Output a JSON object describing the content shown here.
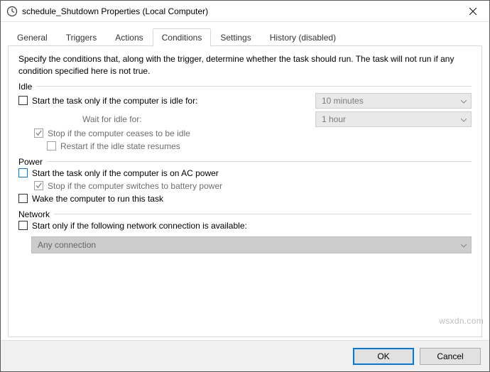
{
  "window": {
    "title": "schedule_Shutdown Properties (Local Computer)"
  },
  "tabs": {
    "general": "General",
    "triggers": "Triggers",
    "actions": "Actions",
    "conditions": "Conditions",
    "settings": "Settings",
    "history": "History (disabled)",
    "active": "conditions"
  },
  "conditions": {
    "description": "Specify the conditions that, along with the trigger, determine whether the task should run.  The task will not run  if any condition specified here is not true.",
    "idle": {
      "label": "Idle",
      "start_only_if_idle": {
        "checked": false,
        "label": "Start the task only if the computer is idle for:",
        "value": "10 minutes"
      },
      "wait_label": "Wait for idle for:",
      "wait_value": "1 hour",
      "stop_if_not_idle": {
        "checked": true,
        "label": "Stop if the computer ceases to be idle",
        "enabled": false
      },
      "restart_if_resumes": {
        "checked": false,
        "label": "Restart if the idle state resumes",
        "enabled": false
      }
    },
    "power": {
      "label": "Power",
      "start_on_ac": {
        "checked": false,
        "label": "Start the task only if the computer is on AC power"
      },
      "stop_on_battery": {
        "checked": true,
        "label": "Stop if the computer switches to battery power",
        "enabled": false
      },
      "wake": {
        "checked": false,
        "label": "Wake the computer to run this task"
      }
    },
    "network": {
      "label": "Network",
      "only_if_net": {
        "checked": false,
        "label": "Start only if the following network connection is available:"
      },
      "connection": "Any connection"
    }
  },
  "buttons": {
    "ok": "OK",
    "cancel": "Cancel"
  },
  "watermark": "wsxdn.com"
}
